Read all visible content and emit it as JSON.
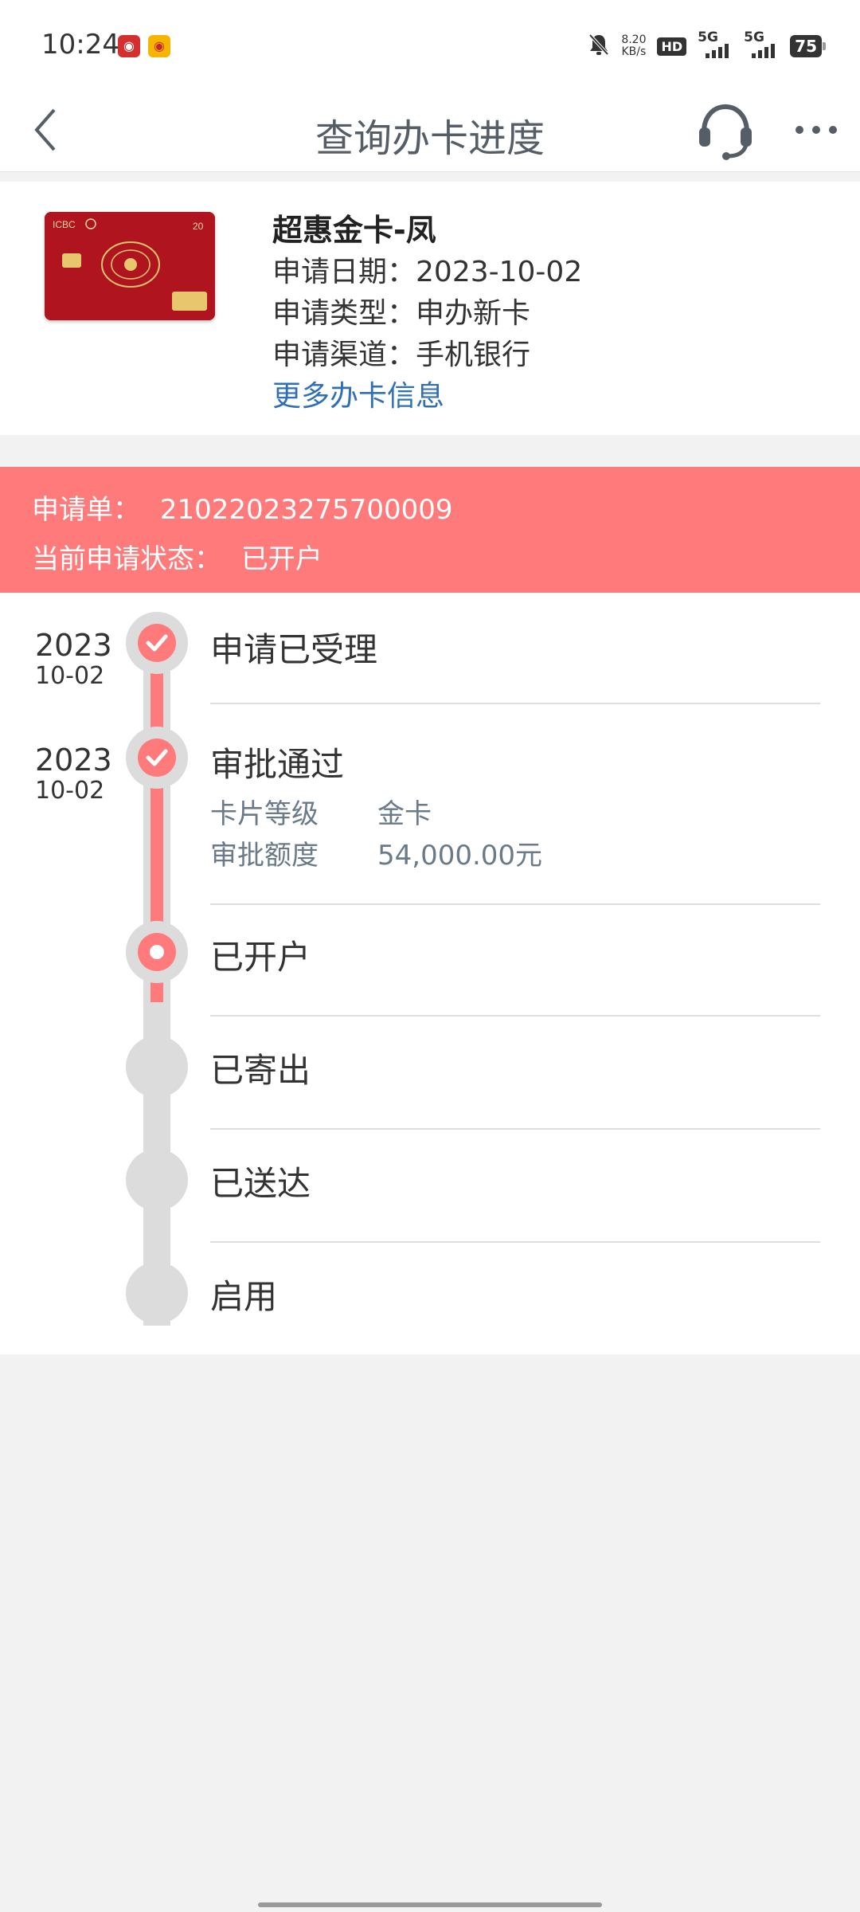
{
  "status_bar": {
    "time": "10:24",
    "speed_value": "8.20",
    "speed_unit": "KB/s",
    "hd_label": "HD",
    "signal_1": "5G",
    "signal_2": "5G",
    "battery": "75"
  },
  "header": {
    "title": "查询办卡进度"
  },
  "card_info": {
    "name": "超惠金卡-凤",
    "apply_date_label": "申请日期：",
    "apply_date": "2023-10-02",
    "apply_type_label": "申请类型：",
    "apply_type": "申办新卡",
    "apply_channel_label": "申请渠道：",
    "apply_channel": "手机银行",
    "more_link": "更多办卡信息",
    "card_brand_text": "ICBC"
  },
  "banner": {
    "order_label": "申请单：",
    "order_number": "21022023275700009",
    "status_label": "当前申请状态：",
    "status_value": "已开户"
  },
  "timeline": {
    "steps": [
      {
        "label": "申请已受理",
        "year": "2023",
        "monthday": "10-02",
        "state": "done"
      },
      {
        "label": "审批通过",
        "year": "2023",
        "monthday": "10-02",
        "state": "done",
        "details": [
          {
            "key": "卡片等级",
            "value": "金卡"
          },
          {
            "key": "审批额度",
            "value": "54,000.00元"
          }
        ]
      },
      {
        "label": "已开户",
        "state": "current"
      },
      {
        "label": "已寄出",
        "state": "pending"
      },
      {
        "label": "已送达",
        "state": "pending"
      },
      {
        "label": "启用",
        "state": "pending"
      }
    ]
  },
  "colors": {
    "accent": "#ff7b7b",
    "link": "#2f6fb5",
    "title": "#555e66",
    "detail": "#6a7a88",
    "track_pending": "#dcdcdc",
    "background": "#f2f2f2"
  },
  "icons": {
    "back": "chevron-left-icon",
    "support": "headset-icon",
    "more": "more-dots-icon",
    "check": "check-icon"
  }
}
